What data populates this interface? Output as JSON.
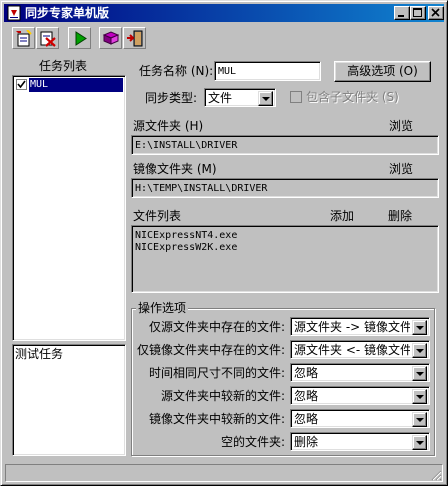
{
  "window": {
    "title": "同步专家单机版"
  },
  "task_list": {
    "header": "任务列表",
    "items": [
      {
        "label": "MUL",
        "checked": true
      }
    ]
  },
  "test_task_label": "测试任务",
  "task_name": {
    "label": "任务名称 (N):",
    "value": "MUL"
  },
  "advanced_button": "高级选项 (O)",
  "sync_type": {
    "label": "同步类型:",
    "value": "文件"
  },
  "include_subfolders": {
    "label": "包含子文件夹 (S)",
    "checked": false
  },
  "source_folder": {
    "label": "源文件夹 (H)",
    "browse": "浏览",
    "value": "E:\\INSTALL\\DRIVER"
  },
  "mirror_folder": {
    "label": "镜像文件夹 (M)",
    "browse": "浏览",
    "value": "H:\\TEMP\\INSTALL\\DRIVER"
  },
  "file_list": {
    "label": "文件列表",
    "add": "添加",
    "delete": "删除",
    "files": [
      "NICExpressNT4.exe",
      "NICExpressW2K.exe"
    ]
  },
  "operations": {
    "title": "操作选项",
    "rows": [
      {
        "label": "仅源文件夹中存在的文件:",
        "value": "源文件夹 -> 镜像文件"
      },
      {
        "label": "仅镜像文件夹中存在的文件:",
        "value": "源文件夹 <- 镜像文件"
      },
      {
        "label": "时间相同尺寸不同的文件:",
        "value": "忽略"
      },
      {
        "label": "源文件夹中较新的文件:",
        "value": "忽略"
      },
      {
        "label": "镜像文件夹中较新的文件:",
        "value": "忽略"
      },
      {
        "label": "空的文件夹:",
        "value": "删除"
      }
    ]
  },
  "toolbar": {
    "buttons": [
      "new-task-icon",
      "delete-task-icon",
      "run-icon",
      "book-icon",
      "exit-icon"
    ]
  },
  "colors": {
    "title_start": "#000080",
    "title_end": "#1084d0",
    "selection": "#000080"
  }
}
